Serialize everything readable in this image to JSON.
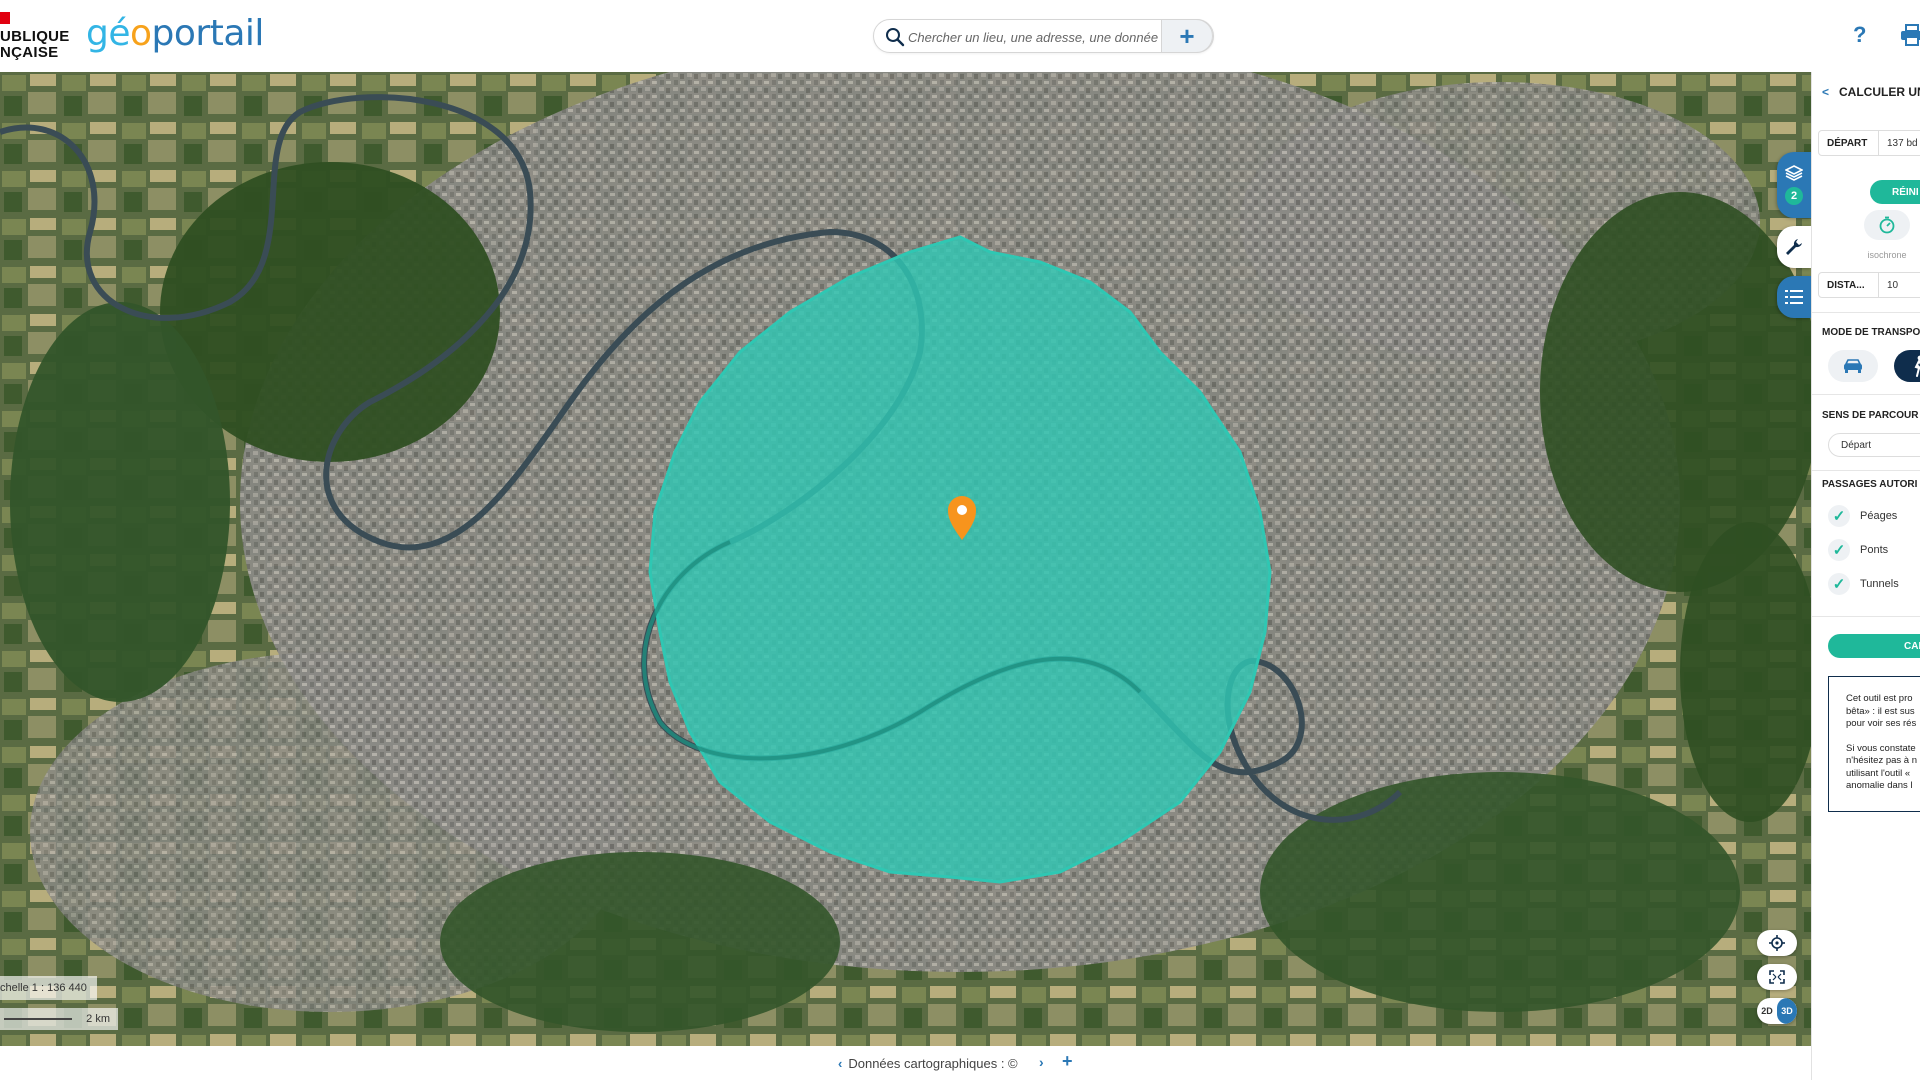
{
  "header": {
    "republic_line1": "UBLIQUE",
    "republic_line2": "NÇAISE",
    "logo_geo": "gé",
    "logo_o": "o",
    "logo_portail": "portail",
    "search_placeholder": "Chercher un lieu, une adresse, une donnée",
    "search_add": "+",
    "help": "?"
  },
  "map": {
    "scale_label": "chelle 1 : 136 440",
    "scale_bar": "2 km",
    "layers_count": "2",
    "view_2d": "2D",
    "view_3d": "3D",
    "isochrone_color": "#2fc7b3",
    "marker_color": "#f7941d"
  },
  "footer": {
    "attribution": "Données cartographiques : ©",
    "prev": "‹",
    "next": "›",
    "add": "+"
  },
  "panel": {
    "title": "CALCULER UN",
    "depart_label": "DÉPART",
    "depart_value": "137 bd",
    "reinit": "RÉINI",
    "isochrone_label": "isochrone",
    "distance_label": "DISTA...",
    "distance_value": "10",
    "transport_title": "MODE DE TRANSPO",
    "direction_title": "SENS DE PARCOUR",
    "direction_value": "Départ",
    "passages_title": "PASSAGES AUTORI",
    "passages": [
      {
        "label": "Péages",
        "checked": true
      },
      {
        "label": "Ponts",
        "checked": true
      },
      {
        "label": "Tunnels",
        "checked": true
      }
    ],
    "calc": "CAL",
    "info_lines_1": [
      "Cet outil est pro",
      "bêta» : il est sus",
      "pour voir ses rés"
    ],
    "info_lines_2": [
      "Si vous constate",
      "n'hésitez pas à n",
      "utilisant l'outil «",
      "anomalie dans l"
    ]
  },
  "colors": {
    "accent": "#2b78b5",
    "teal": "#1fb89a",
    "navy": "#0f2d4c"
  }
}
